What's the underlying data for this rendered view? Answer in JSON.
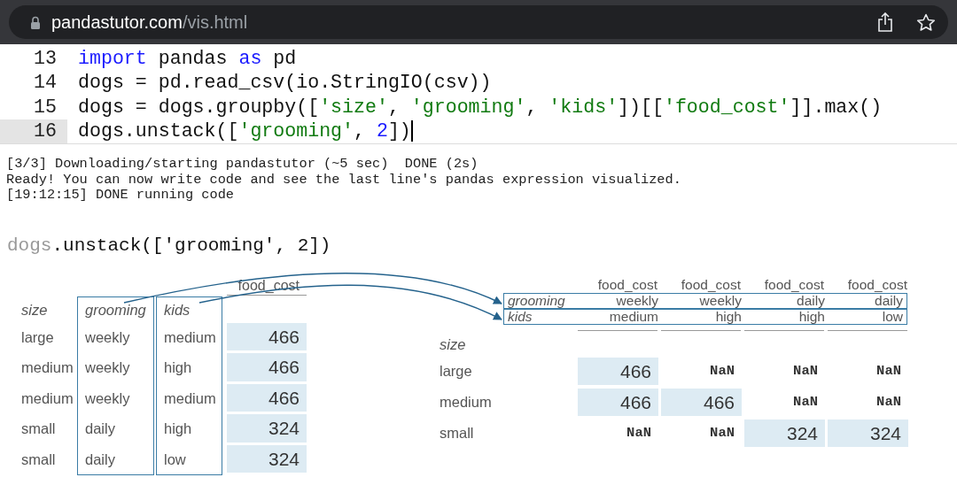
{
  "browser": {
    "url_host": "pandastutor.com",
    "url_path": "/vis.html"
  },
  "editor": {
    "lines": [
      {
        "number": "13",
        "active": false,
        "tokens": [
          {
            "text": "import",
            "kind": "keyword"
          },
          {
            "text": " pandas ",
            "kind": "plain"
          },
          {
            "text": "as",
            "kind": "keyword"
          },
          {
            "text": " pd",
            "kind": "plain"
          }
        ]
      },
      {
        "number": "14",
        "active": false,
        "tokens": [
          {
            "text": "dogs = pd.read_csv(io.StringIO(csv))",
            "kind": "plain"
          }
        ]
      },
      {
        "number": "15",
        "active": false,
        "tokens": [
          {
            "text": "dogs = dogs.groupby([",
            "kind": "plain"
          },
          {
            "text": "'size'",
            "kind": "string"
          },
          {
            "text": ", ",
            "kind": "plain"
          },
          {
            "text": "'grooming'",
            "kind": "string"
          },
          {
            "text": ", ",
            "kind": "plain"
          },
          {
            "text": "'kids'",
            "kind": "string"
          },
          {
            "text": "])[[",
            "kind": "plain"
          },
          {
            "text": "'food_cost'",
            "kind": "string"
          },
          {
            "text": "]].max()",
            "kind": "plain"
          }
        ]
      },
      {
        "number": "16",
        "active": true,
        "tokens": [
          {
            "text": "dogs.unstack([",
            "kind": "plain"
          },
          {
            "text": "'grooming'",
            "kind": "string"
          },
          {
            "text": ", ",
            "kind": "plain"
          },
          {
            "text": "2",
            "kind": "number"
          },
          {
            "text": "])",
            "kind": "plain"
          }
        ]
      }
    ]
  },
  "log": [
    "[3/3] Downloading/starting pandastutor (~5 sec)  DONE (2s)",
    "Ready! You can now write code and see the last line's pandas expression visualized.",
    "[19:12:15] DONE running code"
  ],
  "expression": {
    "object": "dogs",
    "call": ".unstack(['grooming', 2])"
  },
  "left_table": {
    "column": "food_cost",
    "index_names": [
      {
        "text": "size",
        "outlined": false
      },
      {
        "text": "grooming",
        "outlined": true
      },
      {
        "text": "kids",
        "outlined": true
      }
    ],
    "rows": [
      {
        "index": [
          "large",
          "weekly",
          "medium"
        ],
        "value": "466",
        "highlighted": true
      },
      {
        "index": [
          "medium",
          "weekly",
          "high"
        ],
        "value": "466",
        "highlighted": true
      },
      {
        "index": [
          "medium",
          "weekly",
          "medium"
        ],
        "value": "466",
        "highlighted": true
      },
      {
        "index": [
          "small",
          "daily",
          "high"
        ],
        "value": "324",
        "highlighted": true
      },
      {
        "index": [
          "small",
          "daily",
          "low"
        ],
        "value": "324",
        "highlighted": true
      }
    ]
  },
  "right_table": {
    "columns": [
      "food_cost",
      "food_cost",
      "food_cost",
      "food_cost"
    ],
    "header_levels": [
      {
        "name": "grooming",
        "values": [
          "weekly",
          "weekly",
          "daily",
          "daily"
        ],
        "outlined": true
      },
      {
        "name": "kids",
        "values": [
          "medium",
          "high",
          "high",
          "low"
        ],
        "outlined": true
      }
    ],
    "index_name": "size",
    "rows": [
      {
        "label": "large",
        "cells": [
          {
            "text": "466",
            "kind": "value",
            "highlighted": true
          },
          {
            "text": "NaN",
            "kind": "nan",
            "highlighted": false
          },
          {
            "text": "NaN",
            "kind": "nan",
            "highlighted": false
          },
          {
            "text": "NaN",
            "kind": "nan",
            "highlighted": false
          }
        ]
      },
      {
        "label": "medium",
        "cells": [
          {
            "text": "466",
            "kind": "value",
            "highlighted": true
          },
          {
            "text": "466",
            "kind": "value",
            "highlighted": true
          },
          {
            "text": "NaN",
            "kind": "nan",
            "highlighted": false
          },
          {
            "text": "NaN",
            "kind": "nan",
            "highlighted": false
          }
        ]
      },
      {
        "label": "small",
        "cells": [
          {
            "text": "NaN",
            "kind": "nan",
            "highlighted": false
          },
          {
            "text": "NaN",
            "kind": "nan",
            "highlighted": false
          },
          {
            "text": "324",
            "kind": "value",
            "highlighted": true
          },
          {
            "text": "324",
            "kind": "value",
            "highlighted": true
          }
        ]
      }
    ]
  }
}
